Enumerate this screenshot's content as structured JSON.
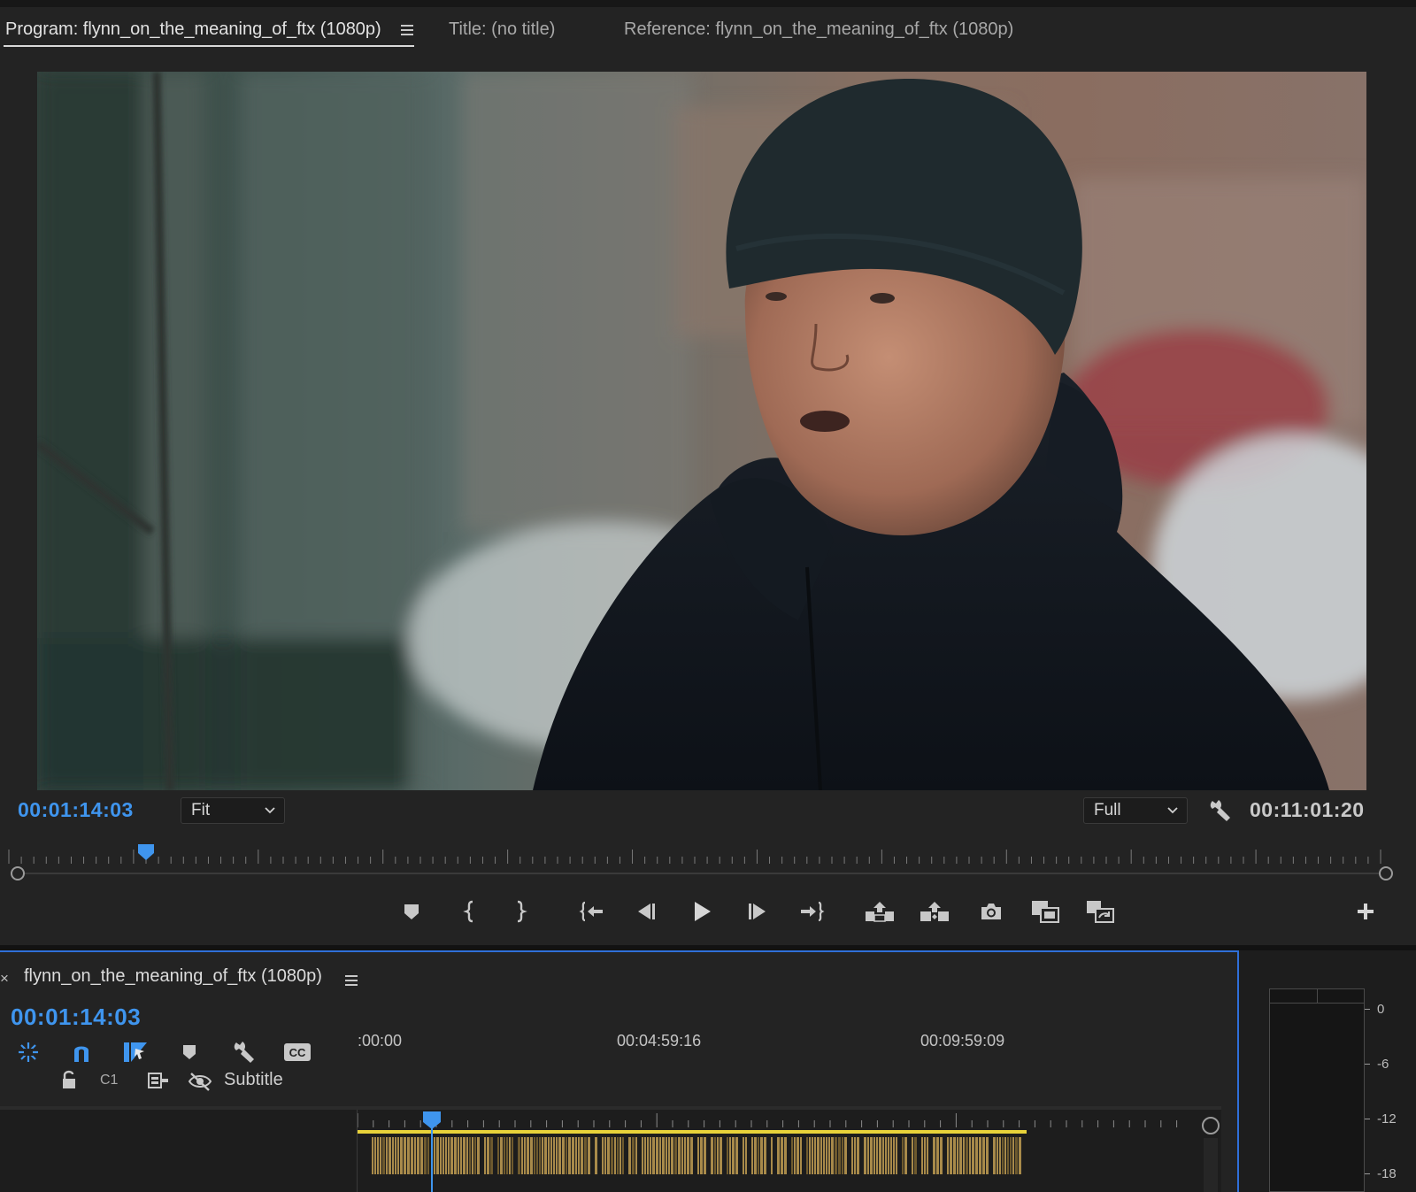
{
  "program_monitor": {
    "tabs": [
      {
        "label": "Program: flynn_on_the_meaning_of_ftx (1080p)",
        "active": true
      },
      {
        "label": "Title: (no title)",
        "active": false
      },
      {
        "label": "Reference: flynn_on_the_meaning_of_ftx (1080p)",
        "active": false
      }
    ],
    "current_timecode": "00:01:14:03",
    "zoom_level": "Fit",
    "playback_resolution": "Full",
    "duration_timecode": "00:11:01:20",
    "playhead_fraction": 0.1,
    "transport_buttons": [
      "add-marker",
      "mark-in",
      "mark-out",
      "go-to-in",
      "step-back",
      "play",
      "step-forward",
      "go-to-out",
      "lift",
      "extract",
      "export-frame",
      "comparison-view",
      "toggle-proxies",
      "button-editor"
    ]
  },
  "timeline": {
    "sequence_name": "flynn_on_the_meaning_of_ftx (1080p)",
    "current_timecode": "00:01:14:03",
    "ruler_labels": [
      ":00:00",
      "00:04:59:16",
      "00:09:59:09"
    ],
    "tools": [
      "nest-sequence",
      "snap",
      "linked-selection",
      "add-marker",
      "timeline-settings",
      "captions"
    ],
    "track": {
      "id": "C1",
      "name": "Subtitle"
    },
    "playhead_fraction": 0.1
  },
  "audio_meter": {
    "scale": [
      "0",
      "-6",
      "-12",
      "-18"
    ]
  },
  "colors": {
    "accent_blue": "#3f95ee",
    "selection_border": "#2f6fd8",
    "caption_bar": "#e8d23a",
    "caption_clips": "#a88a4a"
  }
}
